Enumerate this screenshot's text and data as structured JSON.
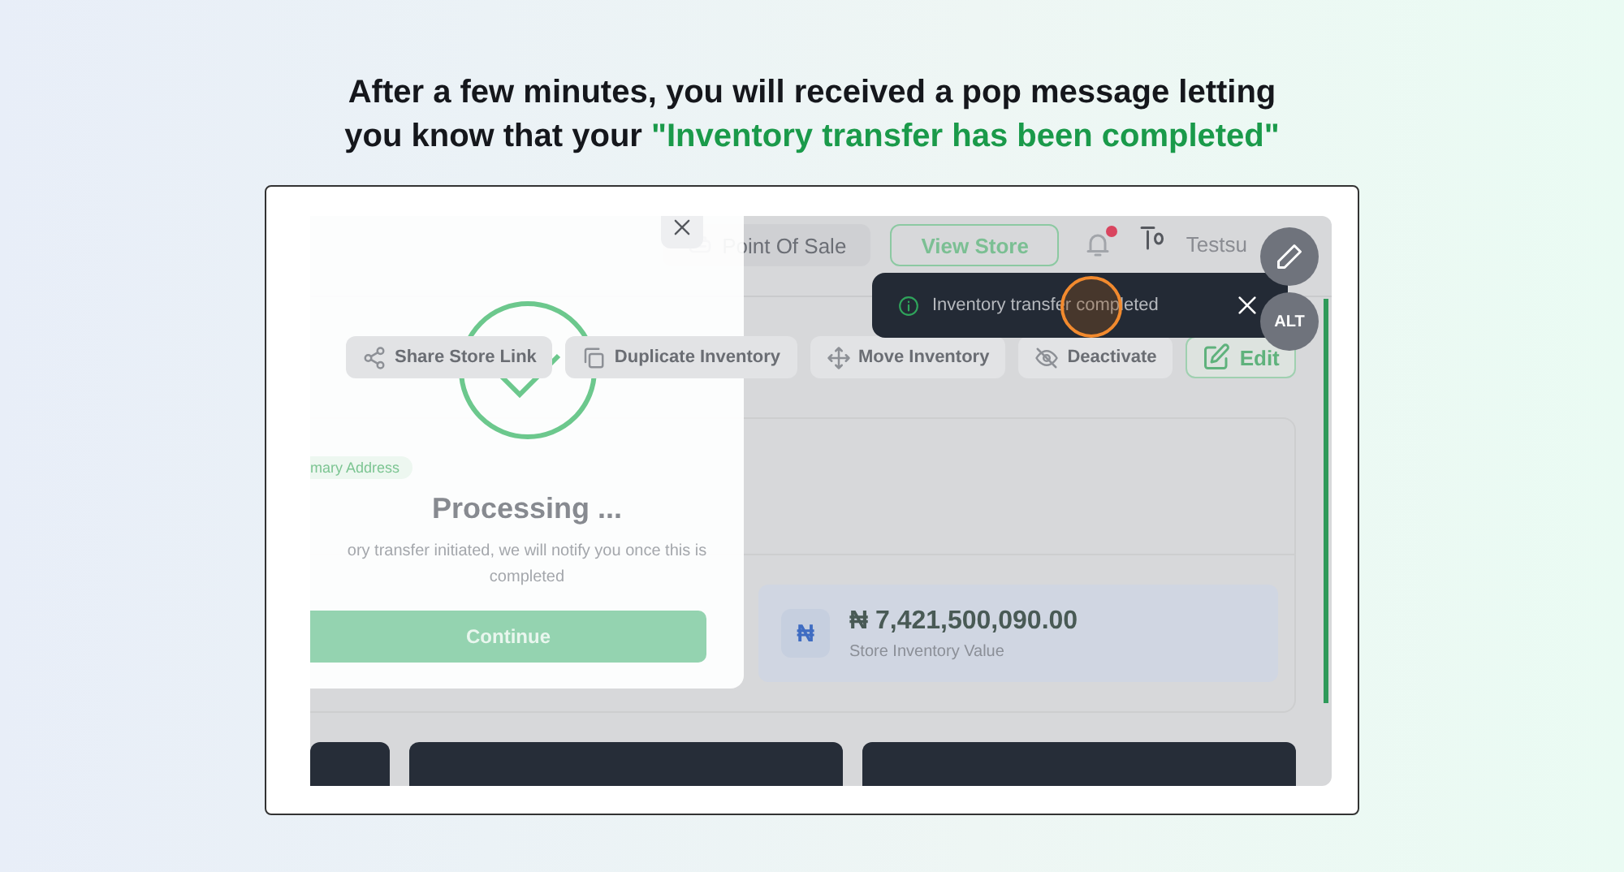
{
  "heading": {
    "line_1": "After a few minutes, you will received a pop message letting",
    "line_2": "you know that your ",
    "highlight": "\"Inventory transfer has been completed\""
  },
  "app": {
    "topbar": {
      "buttons": [
        {
          "label": "Point Of Sale",
          "kind": "pos"
        },
        {
          "label": "View Store",
          "kind": "outline"
        }
      ],
      "notifications_unread": true,
      "user_name": "Testsu"
    },
    "actions": [
      {
        "label": "Share Store Link",
        "kind": "share"
      },
      {
        "label": "Duplicate Inventory",
        "kind": "duplicate"
      },
      {
        "label": "Move Inventory",
        "kind": "move"
      },
      {
        "label": "Deactivate",
        "kind": "deactivate"
      },
      {
        "label": "Edit",
        "kind": "edit"
      }
    ],
    "store_value": {
      "currency_symbol": "₦",
      "amount": "₦ 7,421,500,090.00",
      "label": "Store Inventory Value"
    }
  },
  "modal": {
    "address_tag": "mary Address",
    "title": "Processing ...",
    "message": "ory transfer initiated, we will notify you once this is completed",
    "button": "Continue"
  },
  "toast": {
    "message": "Inventory transfer completed"
  },
  "floating_buttons": [
    {
      "kind": "edit"
    },
    {
      "kind": "alt",
      "label": "ALT"
    }
  ]
}
